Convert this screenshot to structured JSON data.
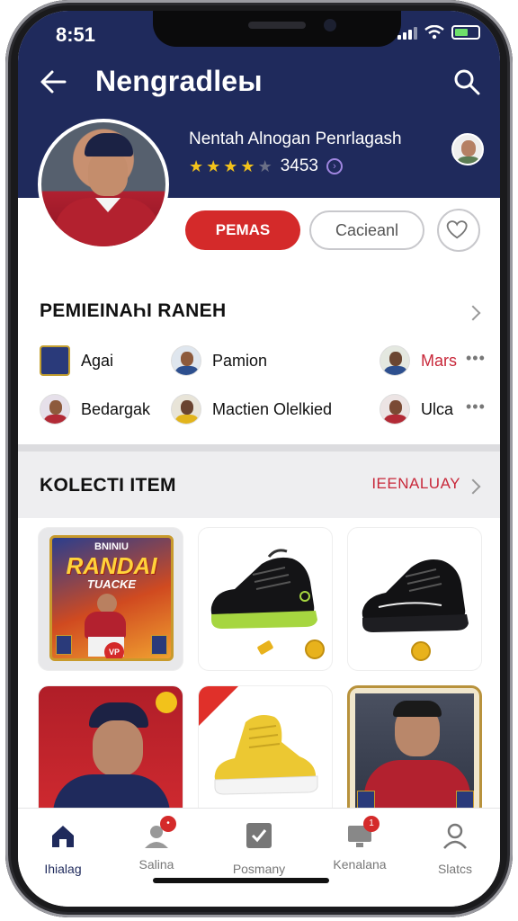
{
  "status": {
    "time": "8:51"
  },
  "header": {
    "title": "Nengradleы",
    "profile_name": "Nentah Alnogan Penrlagash",
    "rating_value": "3453",
    "rating_stars": 4
  },
  "actions": {
    "primary_label": "PEMAS",
    "secondary_label": "Cacieanl"
  },
  "people_section": {
    "title": "PEMIEINAҺI RANEH",
    "items": [
      {
        "label": "Agai"
      },
      {
        "label": "Pamion"
      },
      {
        "label": "Mars"
      },
      {
        "label": "Bedargak"
      },
      {
        "label": "Mactien Olelkied"
      },
      {
        "label": "Ulca"
      }
    ]
  },
  "collection": {
    "title": "KOLECTI ITEM",
    "see_all": "IEENALUAY",
    "card_text_1": "RANDAI",
    "card_text_2": "TUACKE",
    "card_text_top": "BNINIU",
    "card_badge": "VP"
  },
  "nav": {
    "items": [
      {
        "label": "Ihialag"
      },
      {
        "label": "Salina"
      },
      {
        "label": "Posmany"
      },
      {
        "label": "Kenalana"
      },
      {
        "label": "Slatcs"
      }
    ]
  },
  "colors": {
    "navy": "#1f2a5c",
    "accent_red": "#d42a2a",
    "star": "#f2c21b"
  }
}
